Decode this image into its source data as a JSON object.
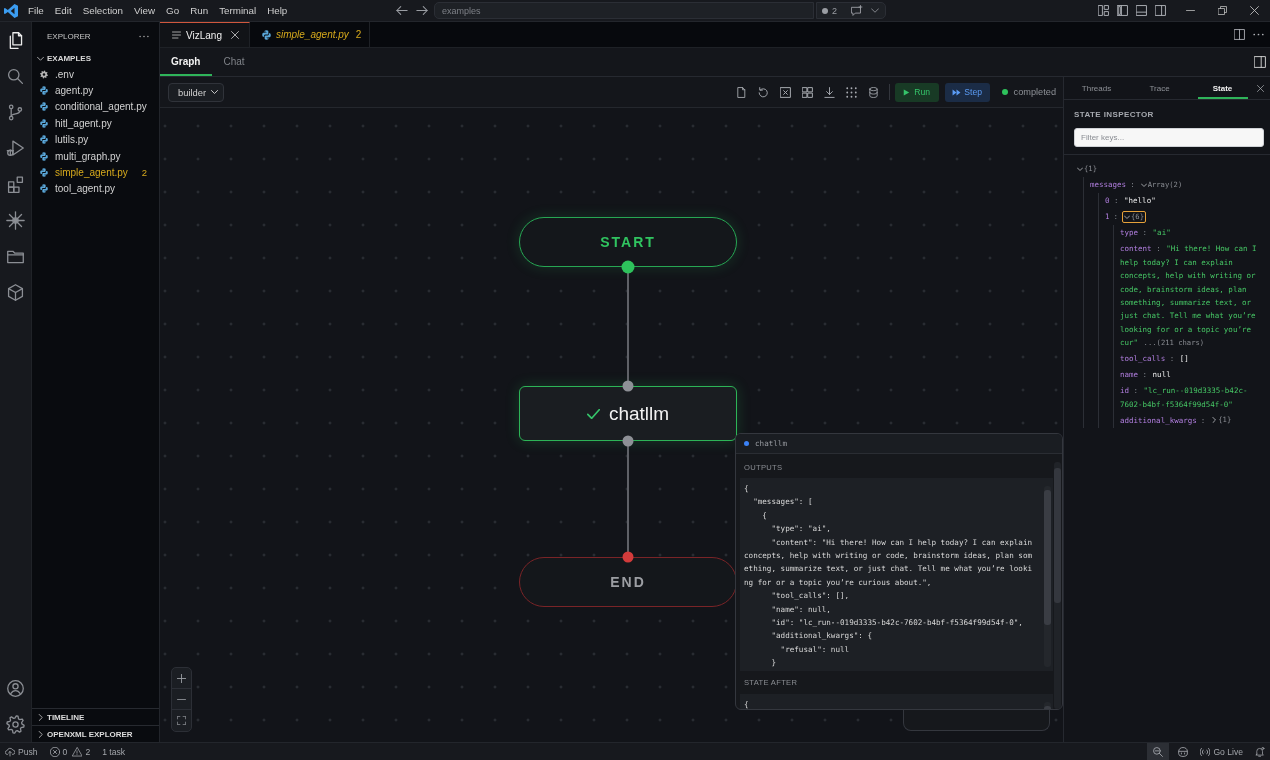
{
  "title_bar": {
    "menu": [
      "File",
      "Edit",
      "Selection",
      "View",
      "Go",
      "Run",
      "Terminal",
      "Help"
    ],
    "command_center": "examples",
    "indicator_count": "2"
  },
  "activity_bar": {
    "items": [
      {
        "kind": "files",
        "selected": true
      },
      {
        "kind": "search",
        "selected": false
      },
      {
        "kind": "source-control",
        "selected": false
      },
      {
        "kind": "run-debug",
        "selected": false
      },
      {
        "kind": "extensions",
        "selected": false
      },
      {
        "kind": "graph",
        "selected": false
      },
      {
        "kind": "folder",
        "selected": false
      },
      {
        "kind": "box",
        "selected": false
      }
    ],
    "bottom_items": [
      {
        "kind": "account",
        "selected": false
      },
      {
        "kind": "settings",
        "selected": false
      }
    ]
  },
  "sidebar": {
    "title": "EXPLORER",
    "folder": {
      "label": "EXAMPLES",
      "expanded": true,
      "files": [
        {
          "name": ".env",
          "kind": "config",
          "warning": false
        },
        {
          "name": "agent.py",
          "kind": "python",
          "warning": false
        },
        {
          "name": "conditional_agent.py",
          "kind": "python",
          "warning": false
        },
        {
          "name": "hitl_agent.py",
          "kind": "python",
          "warning": false
        },
        {
          "name": "lutils.py",
          "kind": "python",
          "warning": false
        },
        {
          "name": "multi_graph.py",
          "kind": "python",
          "warning": false
        },
        {
          "name": "simple_agent.py",
          "kind": "python",
          "warning": true,
          "badge": "2"
        },
        {
          "name": "tool_agent.py",
          "kind": "python",
          "warning": false
        }
      ]
    },
    "panels": [
      {
        "label": "TIMELINE",
        "expanded": false
      },
      {
        "label": "OPENXML EXPLORER",
        "expanded": false
      }
    ]
  },
  "editor_tabs": [
    {
      "label": "VizLang",
      "kind": "viz",
      "selected": true,
      "preview": false,
      "warning": false
    },
    {
      "label": "simple_agent.py",
      "kind": "python",
      "selected": false,
      "preview": true,
      "warning": true,
      "badge": "2"
    }
  ],
  "view_tabs": [
    {
      "label": "Graph",
      "selected": true
    },
    {
      "label": "Chat",
      "selected": false
    }
  ],
  "toolbar": {
    "graph_select": "builder",
    "run": "Run",
    "step": "Step",
    "status": "completed"
  },
  "graph": {
    "nodes": [
      {
        "label": "START",
        "kind": "start",
        "done": false
      },
      {
        "label": "chatllm",
        "kind": "node",
        "done": true
      },
      {
        "label": "END",
        "kind": "end",
        "done": false
      }
    ]
  },
  "node_panel": {
    "title": "chatllm",
    "sections": [
      {
        "label": "OUTPUTS",
        "lines": [
          "{",
          "  \"messages\": [",
          "    {",
          "      \"type\": \"ai\",",
          "      \"content\": \"Hi there! How can I help today? I can explain concepts, help with writing or code, brainstorm ideas, plan something, summarize text, or just chat. Tell me what you’re looking for or a topic you’re curious about.\",",
          "      \"tool_calls\": [],",
          "      \"name\": null,",
          "      \"id\": \"lc_run--019d3335-b42c-7602-b4bf-f5364f99d54f-0\",",
          "      \"additional_kwargs\": {",
          "        \"refusal\": null",
          "      }"
        ]
      },
      {
        "label": "STATE AFTER",
        "lines": [
          "{"
        ]
      }
    ]
  },
  "inspector": {
    "tabs": [
      {
        "label": "Threads",
        "selected": false
      },
      {
        "label": "Trace",
        "selected": false
      },
      {
        "label": "State",
        "selected": true
      }
    ],
    "title": "STATE INSPECTOR",
    "filter": {
      "placeholder": "Filter keys..."
    },
    "key_separator": ":",
    "tree": {
      "summary": "{1}",
      "expanded": true,
      "selected": false,
      "children": [
        {
          "key": "messages",
          "summary": "Array(2)",
          "expanded": true,
          "selected": false,
          "children": [
            {
              "key": "0",
              "value": "\"hello\"",
              "kind": "text",
              "selected": false
            },
            {
              "key": "1",
              "summary": "{6}",
              "expanded": true,
              "selected": true,
              "children": [
                {
                  "key": "type",
                  "value": "\"ai\"",
                  "kind": "string",
                  "selected": false
                },
                {
                  "key": "content",
                  "value": "\"Hi there! How can I help today? I can explain concepts, help with writing or code, brainstorm ideas, plan something, summarize text, or just chat. Tell me what you’re looking for or a topic you’re cur\"",
                  "note": "...(211 chars)",
                  "kind": "string",
                  "selected": false
                },
                {
                  "key": "tool_calls",
                  "value": "[]",
                  "kind": "text",
                  "selected": false
                },
                {
                  "key": "name",
                  "value": "null",
                  "kind": "text",
                  "selected": false
                },
                {
                  "key": "id",
                  "value": "\"lc_run--019d3335-b42c-7602-b4bf-f5364f99d54f-0\"",
                  "kind": "string",
                  "selected": false
                },
                {
                  "key": "additional_kwargs",
                  "summary": "{1}",
                  "expanded": false,
                  "selected": false
                }
              ]
            }
          ]
        }
      ]
    }
  },
  "status_bar": {
    "push": "Push",
    "errors": "0",
    "warnings": "2",
    "tasks": "1 task",
    "go_live": "Go Live"
  }
}
